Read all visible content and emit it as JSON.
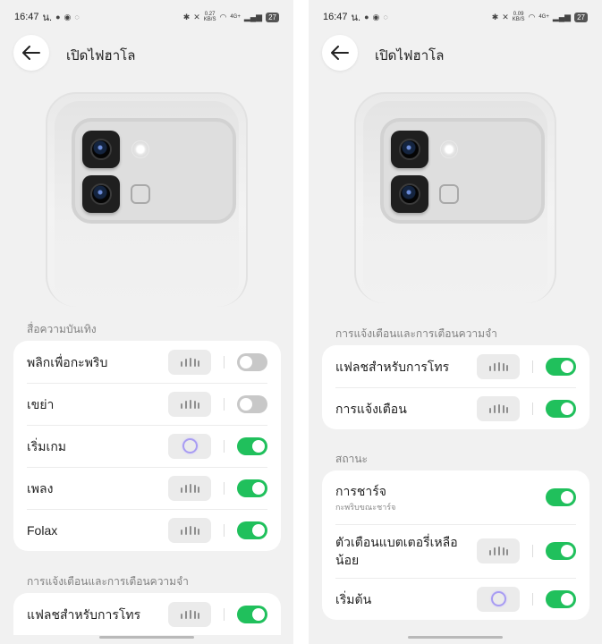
{
  "status": {
    "time": "16:47",
    "suffix": "น.",
    "net_left": "0.27",
    "net_right": "0.09",
    "net_unit": "KB/S",
    "signal": "4G+",
    "battery": "27"
  },
  "header": {
    "title": "เปิดไฟฮาโล"
  },
  "left": {
    "section_entertainment": "สื่อความบันเทิง",
    "entertainment": [
      {
        "label": "พลิกเพื่อกะพริบ",
        "indicator": "pattern",
        "enabled": false
      },
      {
        "label": "เขย่า",
        "indicator": "pattern",
        "enabled": false
      },
      {
        "label": "เริ่มเกม",
        "indicator": "ring",
        "enabled": true
      },
      {
        "label": "เพลง",
        "indicator": "pattern",
        "enabled": true
      },
      {
        "label": "Folax",
        "indicator": "pattern",
        "enabled": true
      }
    ],
    "section_notifications": "การแจ้งเตือนและการเตือนความจำ",
    "notifications": [
      {
        "label": "แฟลชสำหรับการโทร",
        "indicator": "pattern",
        "enabled": true
      }
    ]
  },
  "right": {
    "section_notifications": "การแจ้งเตือนและการเตือนความจำ",
    "notifications": [
      {
        "label": "แฟลชสำหรับการโทร",
        "indicator": "pattern",
        "enabled": true
      },
      {
        "label": "การแจ้งเตือน",
        "indicator": "pattern",
        "enabled": true
      }
    ],
    "section_status": "สถานะ",
    "status": [
      {
        "label": "การชาร์จ",
        "sub": "กะพริบขณะชาร์จ",
        "indicator": "none",
        "enabled": true
      },
      {
        "label": "ตัวเตือนแบตเตอรี่เหลือน้อย",
        "indicator": "pattern",
        "enabled": true
      },
      {
        "label": "เริ่มต้น",
        "indicator": "ring",
        "enabled": true
      }
    ]
  },
  "colors": {
    "toggle_on": "#20c05c",
    "toggle_off": "#c8c8c8",
    "ring": "#a89cf2"
  },
  "icons": {
    "back": "arrow-left-icon",
    "pattern": "light-pattern-icon",
    "ring": "halo-ring-icon"
  }
}
